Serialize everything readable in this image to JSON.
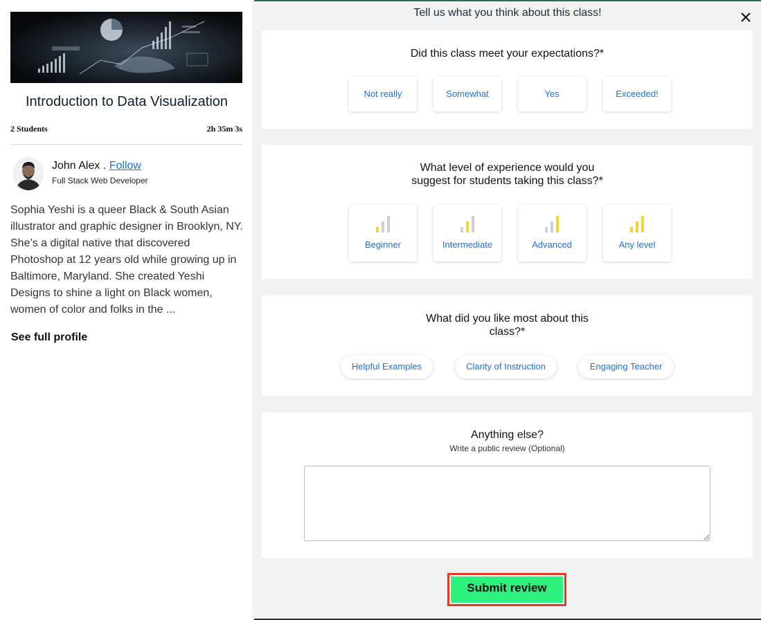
{
  "course": {
    "title": "Introduction to Data Visualization",
    "students": "2 Students",
    "duration": "2h 35m 3s"
  },
  "instructor": {
    "name": "John Alex .",
    "follow_label": "Follow",
    "role": "Full Stack Web Developer",
    "bio": "Sophia Yeshi is a queer Black & South Asian illustrator and graphic designer in Brooklyn, NY. She’s a digital native that discovered Photoshop at 12 years old while growing up in Baltimore, Maryland. She created Yeshi Designs to shine a light on Black women, women of color and folks in the ...",
    "see_profile_label": "See full profile"
  },
  "review": {
    "title": "Tell us what you think about this class!",
    "close_icon": "close-icon",
    "q1": {
      "question": "Did this class meet your expectations?*",
      "options": [
        "Not really",
        "Somewhat",
        "Yes",
        "Exceeded!"
      ]
    },
    "q2": {
      "question_line1": "What level of experience would you",
      "question_line2": "suggest for students taking this class?*",
      "options": [
        {
          "label": "Beginner",
          "icon": "signal-1-bar-icon",
          "filled_bars": 1
        },
        {
          "label": "Intermediate",
          "icon": "signal-2-bars-icon",
          "filled_bars": 2
        },
        {
          "label": "Advanced",
          "icon": "signal-3-bars-icon",
          "filled_bars": 3
        },
        {
          "label": "Any level",
          "icon": "signal-all-bars-icon",
          "filled_bars": 3
        }
      ]
    },
    "q3": {
      "question_line1": "What did you like most about this",
      "question_line2": "class?*",
      "options": [
        "Helpful Examples",
        "Clarity of Instruction",
        "Engaging Teacher"
      ]
    },
    "q4": {
      "question": "Anything else?",
      "subtitle": "Write a public review (Optional)",
      "value": ""
    },
    "submit_label": "Submit review"
  },
  "colors": {
    "accent_blue": "#1a73e8",
    "bar_active": "#f2d633",
    "bar_inactive": "#d0d0d0",
    "submit_bg": "#2ef07c",
    "submit_border": "#e53a1e"
  }
}
